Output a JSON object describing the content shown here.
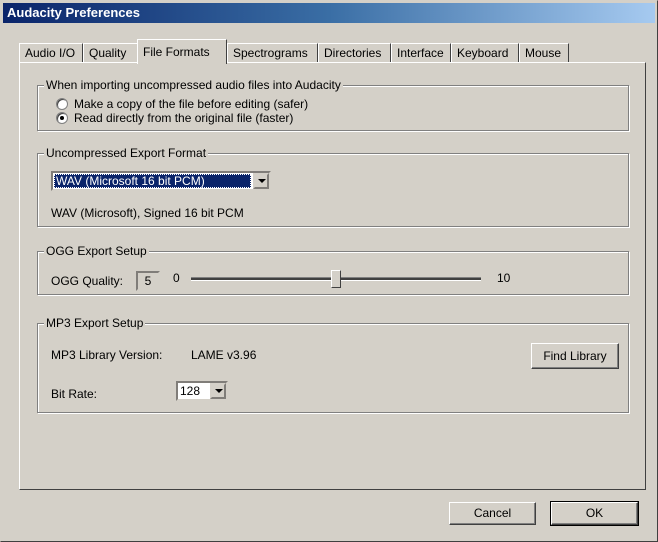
{
  "window": {
    "title": "Audacity Preferences"
  },
  "tabs": [
    {
      "label": "Audio I/O"
    },
    {
      "label": "Quality"
    },
    {
      "label": "File Formats"
    },
    {
      "label": "Spectrograms"
    },
    {
      "label": "Directories"
    },
    {
      "label": "Interface"
    },
    {
      "label": "Keyboard"
    },
    {
      "label": "Mouse"
    }
  ],
  "import_group": {
    "title": "When importing uncompressed audio files into Audacity",
    "options": [
      {
        "label": "Make a copy of the file before editing (safer)",
        "selected": false
      },
      {
        "label": "Read directly from the original file (faster)",
        "selected": true
      }
    ]
  },
  "export_group": {
    "title": "Uncompressed Export Format",
    "format_selected": "WAV (Microsoft 16 bit PCM)",
    "format_description": "WAV (Microsoft), Signed 16 bit PCM"
  },
  "ogg_group": {
    "title": "OGG Export Setup",
    "quality_label": "OGG Quality:",
    "quality_value": "5",
    "min_label": "0",
    "max_label": "10",
    "slider_fraction": 0.5
  },
  "mp3_group": {
    "title": "MP3 Export Setup",
    "library_label": "MP3 Library Version:",
    "library_value": "LAME v3.96",
    "find_library_label": "Find Library",
    "bitrate_label": "Bit Rate:",
    "bitrate_value": "128"
  },
  "buttons": {
    "cancel": "Cancel",
    "ok": "OK"
  }
}
